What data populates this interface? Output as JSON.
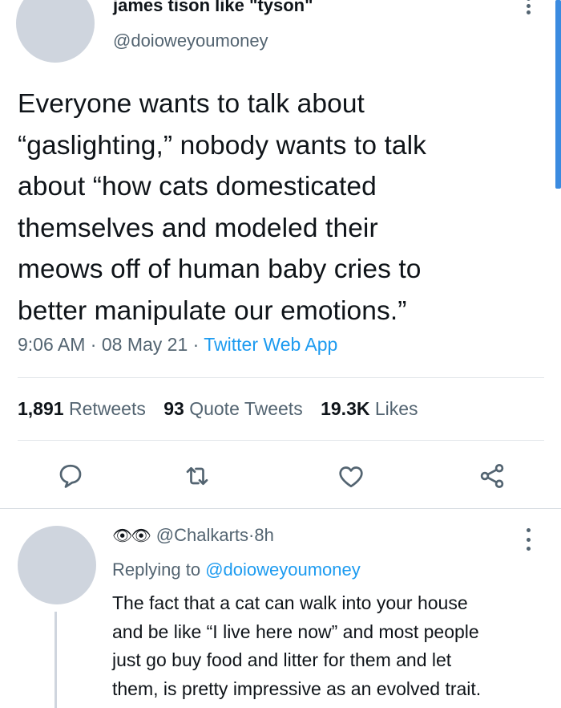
{
  "tweet": {
    "display_name": "james tison like \"tyson\"",
    "handle": "@doioweyoumoney",
    "text": "Everyone wants to talk about\n“gaslighting,” nobody wants to talk\nabout “how cats domesticated\nthemselves and modeled their\nmeows off of human baby cries to\nbetter manipulate our emotions.”",
    "time": "9:06 AM",
    "date": "08 May 21",
    "separator": " · ",
    "source": "Twitter Web App"
  },
  "stats": {
    "retweets_count": "1,891",
    "retweets_label": "Retweets",
    "quotes_count": "93",
    "quotes_label": "Quote Tweets",
    "likes_count": "19.3K",
    "likes_label": "Likes"
  },
  "actions": {
    "icons": [
      "reply-icon",
      "retweet-icon",
      "like-icon",
      "share-icon"
    ]
  },
  "reply": {
    "emoji": "👁👁",
    "handle": "@Chalkarts",
    "time_sep": " · ",
    "time": "8h",
    "replying_prefix": "Replying to ",
    "replying_to": "@doioweyoumoney",
    "text": "The fact that a cat can walk into your house\nand be like “I live here now” and most people\njust go buy food and litter for them and let\nthem, is pretty impressive as an evolved trait."
  },
  "colors": {
    "accent": "#1d9bf0",
    "secondary_text": "#536471",
    "primary_text": "#0f1419",
    "avatar_placeholder": "#cfd5de"
  }
}
